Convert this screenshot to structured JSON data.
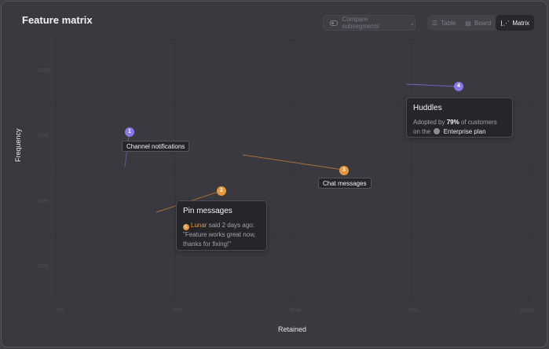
{
  "header": {
    "title": "Feature matrix",
    "compare_label": "Compare subsegments",
    "views": [
      {
        "label": "Table",
        "icon": "table-icon"
      },
      {
        "label": "Board",
        "icon": "board-icon"
      },
      {
        "label": "Matrix",
        "icon": "chart-icon",
        "active": true
      }
    ]
  },
  "matrix": {
    "x_axis_label": "Retained",
    "y_axis_label": "Frequency",
    "y_ticks": [
      "100%",
      "75%",
      "50%",
      "25%"
    ],
    "x_ticks": [
      "0%",
      "25%",
      "50%",
      "75%",
      "100%"
    ]
  },
  "points": [
    {
      "id": "1",
      "label": "Channel notifications",
      "color": "#8a78ea"
    },
    {
      "id": "2",
      "label": "Pin messages",
      "color": "#e8963a"
    },
    {
      "id": "3",
      "label": "Chat messages",
      "color": "#e8963a"
    },
    {
      "id": "4",
      "label": "Huddles",
      "color": "#8a78ea"
    }
  ],
  "huddles_card": {
    "title": "Huddles",
    "prefix": "Adopted by",
    "percent": "79%",
    "mid": "of customers",
    "line2_prefix": "on the",
    "plan": "Enterprise plan"
  },
  "pin_card": {
    "title": "Pin messages",
    "user": "Lunar",
    "user_initial": "L",
    "said": "said 2 days ago:",
    "quote1": "\"Feature works great now,",
    "quote2": "thanks for fixing!\""
  },
  "colors": {
    "purple": "#8a78ea",
    "orange": "#e8963a",
    "background": "#3a393f"
  }
}
